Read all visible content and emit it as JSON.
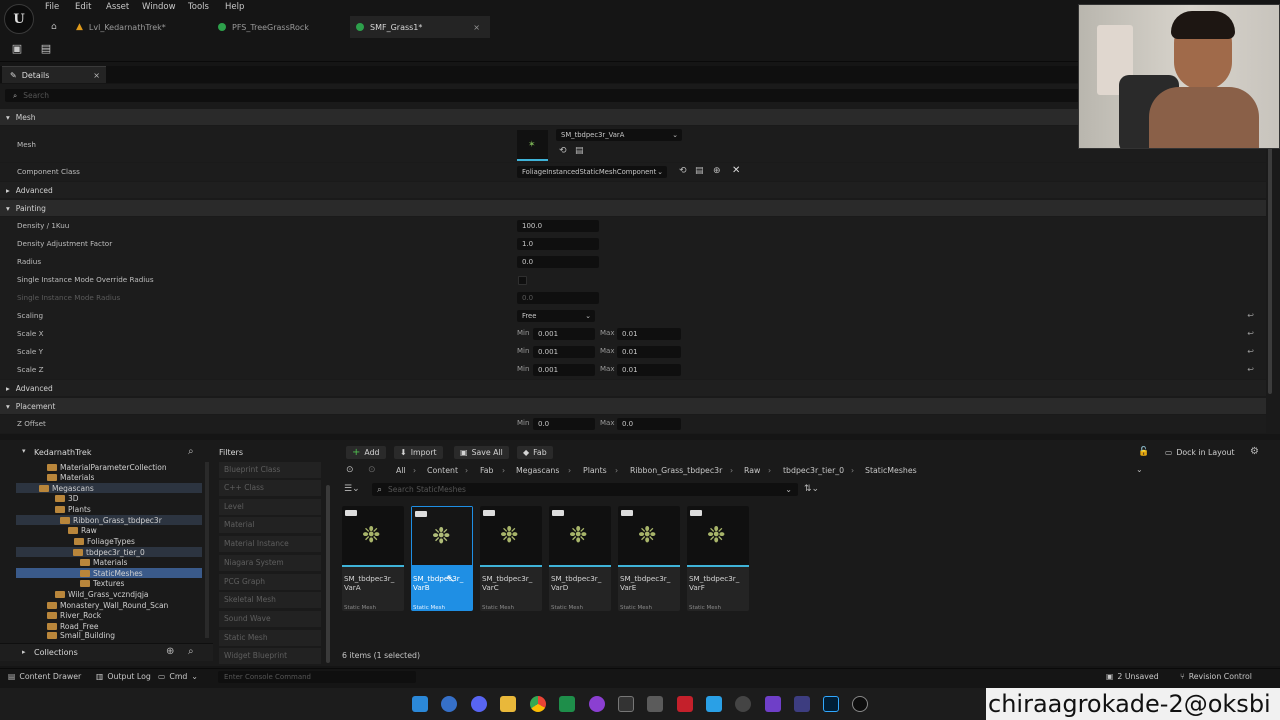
{
  "menu": [
    "File",
    "Edit",
    "Asset",
    "Window",
    "Tools",
    "Help"
  ],
  "tabs": [
    {
      "label": "Lvl_KedarnathTrek*",
      "color": "#e09a1a"
    },
    {
      "label": "PFS_TreeGrassRock",
      "color": "#2da04b"
    },
    {
      "label": "SMF_Grass1*",
      "color": "#2da04b"
    }
  ],
  "details": {
    "tab_label": "Details",
    "search_placeholder": "Search",
    "sections": {
      "mesh": "Mesh",
      "advanced1": "Advanced",
      "painting": "Painting",
      "advanced2": "Advanced",
      "placement": "Placement"
    },
    "mesh_label": "Mesh",
    "mesh_value": "SM_tbdpec3r_VarA",
    "component_class_label": "Component Class",
    "component_class_value": "FoliageInstancedStaticMeshComponent",
    "density_label": "Density / 1Kuu",
    "density_value": "100.0",
    "density_adj_label": "Density Adjustment Factor",
    "density_adj_value": "1.0",
    "radius_label": "Radius",
    "radius_value": "0.0",
    "single_override_label": "Single Instance Mode Override Radius",
    "single_radius_label": "Single Instance Mode Radius",
    "single_radius_value": "0.0",
    "scaling_label": "Scaling",
    "scaling_value": "Free",
    "min_label": "Min",
    "max_label": "Max",
    "scale_x_label": "Scale X",
    "scale_x_min": "0.001",
    "scale_x_max": "0.01",
    "scale_y_label": "Scale Y",
    "scale_y_min": "0.001",
    "scale_y_max": "0.01",
    "scale_z_label": "Scale Z",
    "scale_z_min": "0.001",
    "scale_z_max": "0.01",
    "z_offset_label": "Z Offset",
    "z_offset_min": "0.0",
    "z_offset_max": "0.0"
  },
  "tree": {
    "root": "KedarnathTrek",
    "items": [
      "MaterialParameterCollection",
      "Materials",
      "Megascans",
      "3D",
      "Plants",
      "Ribbon_Grass_tbdpec3r",
      "Raw",
      "FoliageTypes",
      "tbdpec3r_tier_0",
      "Materials",
      "StaticMeshes",
      "Textures",
      "Wild_Grass_vczndjqja",
      "Monastery_Wall_Round_Scan",
      "River_Rock",
      "Road_Free",
      "Small_Building"
    ],
    "collections": "Collections"
  },
  "filters": {
    "title": "Filters",
    "items": [
      "Blueprint Class",
      "C++ Class",
      "Level",
      "Material",
      "Material Instance",
      "Niagara System",
      "PCG Graph",
      "Skeletal Mesh",
      "Sound Wave",
      "Static Mesh",
      "Widget Blueprint"
    ]
  },
  "content_browser": {
    "add": "Add",
    "import": "Import",
    "save_all": "Save All",
    "fab": "Fab",
    "dock": "Dock in Layout",
    "breadcrumb": [
      "All",
      "Content",
      "Fab",
      "Megascans",
      "Plants",
      "Ribbon_Grass_tbdpec3r",
      "Raw",
      "tbdpec3r_tier_0",
      "StaticMeshes"
    ],
    "search_placeholder": "Search StaticMeshes",
    "assets": [
      {
        "name": "SM_tbdpec3r_ VarA",
        "type": "Static Mesh"
      },
      {
        "name": "SM_tbdpec3r_ VarB",
        "type": "Static Mesh"
      },
      {
        "name": "SM_tbdpec3r_ VarC",
        "type": "Static Mesh"
      },
      {
        "name": "SM_tbdpec3r_ VarD",
        "type": "Static Mesh"
      },
      {
        "name": "SM_tbdpec3r_ VarE",
        "type": "Static Mesh"
      },
      {
        "name": "SM_tbdpec3r_ VarF",
        "type": "Static Mesh"
      }
    ],
    "count": "6 items (1 selected)"
  },
  "statusbar": {
    "content_drawer": "Content Drawer",
    "output_log": "Output Log",
    "cmd": "Cmd",
    "console_placeholder": "Enter Console Command",
    "unsaved": "2 Unsaved",
    "revision": "Revision Control"
  },
  "watermark": "chiraagrokade-2@oksbi"
}
